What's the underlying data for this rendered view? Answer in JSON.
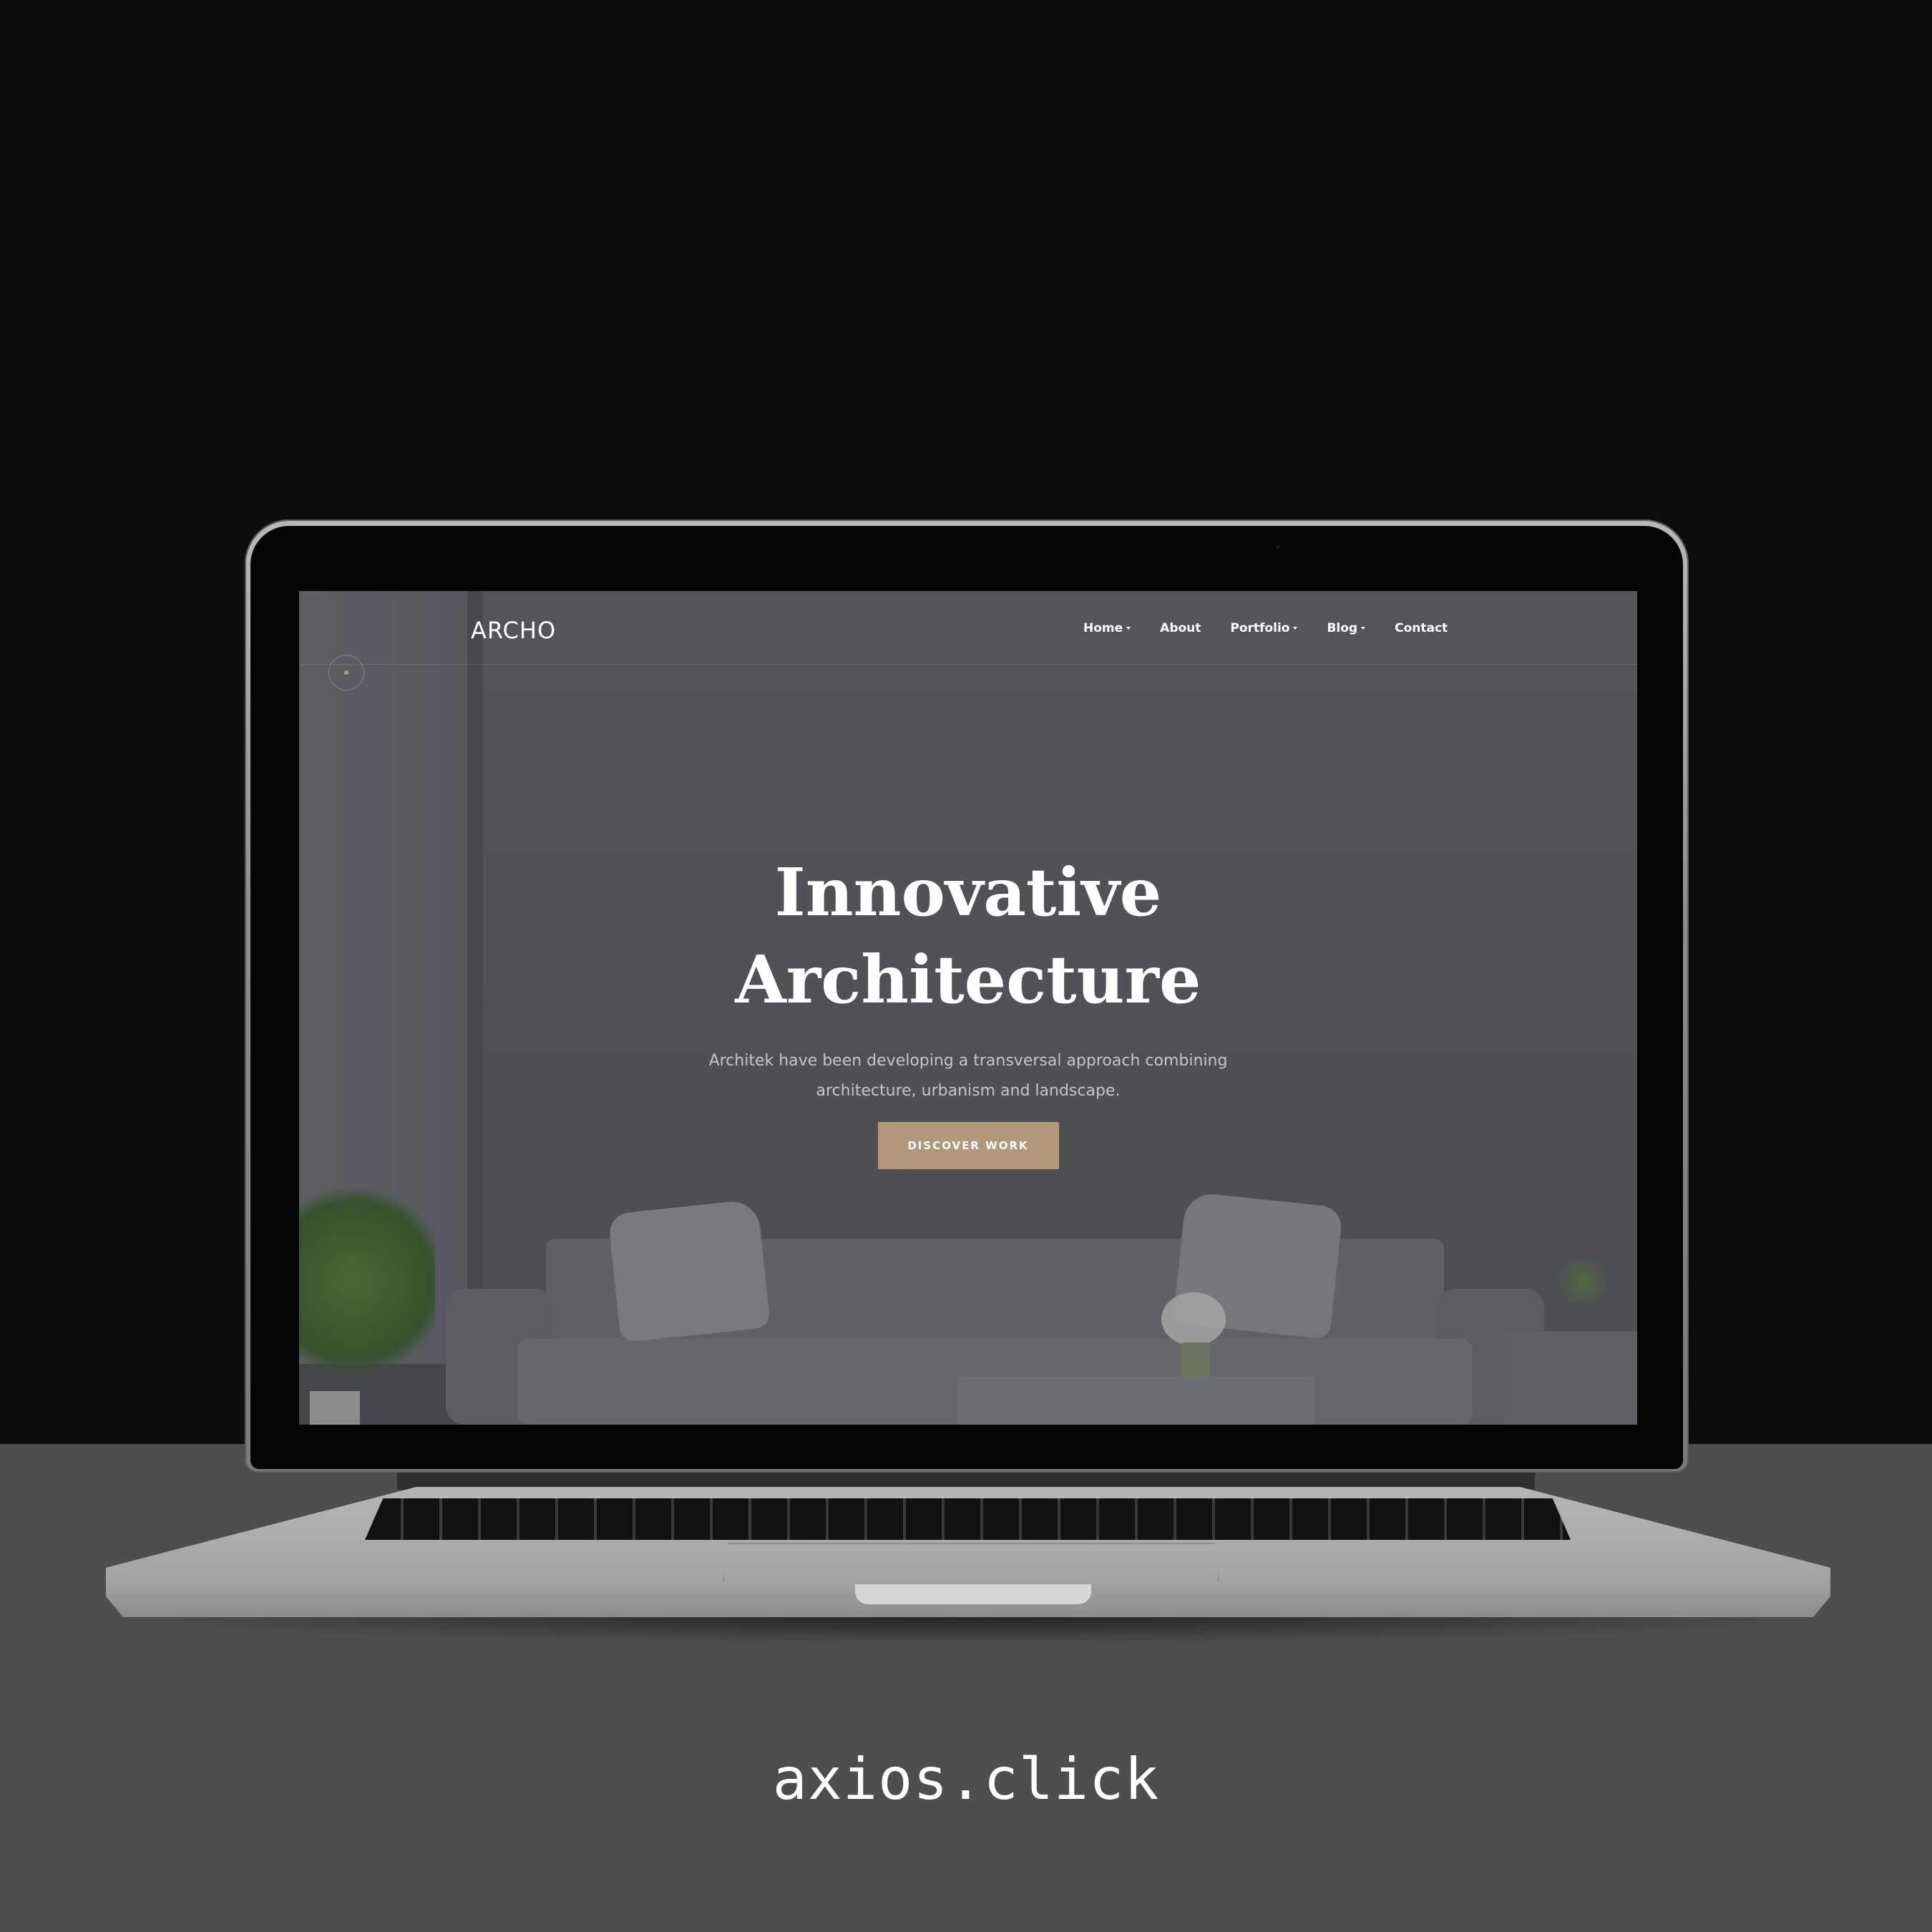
{
  "colors": {
    "background_top": "#0e0e0f",
    "background_bottom": "#4e4e4e",
    "accent": "#b3977a"
  },
  "site": {
    "logo": "ARCHO",
    "nav": [
      {
        "label": "Home",
        "has_dropdown": true
      },
      {
        "label": "About",
        "has_dropdown": false
      },
      {
        "label": "Portfolio",
        "has_dropdown": true
      },
      {
        "label": "Blog",
        "has_dropdown": true
      },
      {
        "label": "Contact",
        "has_dropdown": false
      }
    ]
  },
  "hero": {
    "title_line1": "Innovative",
    "title_line2": "Architecture",
    "subtitle": "Architek have been developing a transversal approach combining architecture, urbanism and landscape.",
    "button_label": "DISCOVER WORK"
  },
  "caption": "axios.click"
}
